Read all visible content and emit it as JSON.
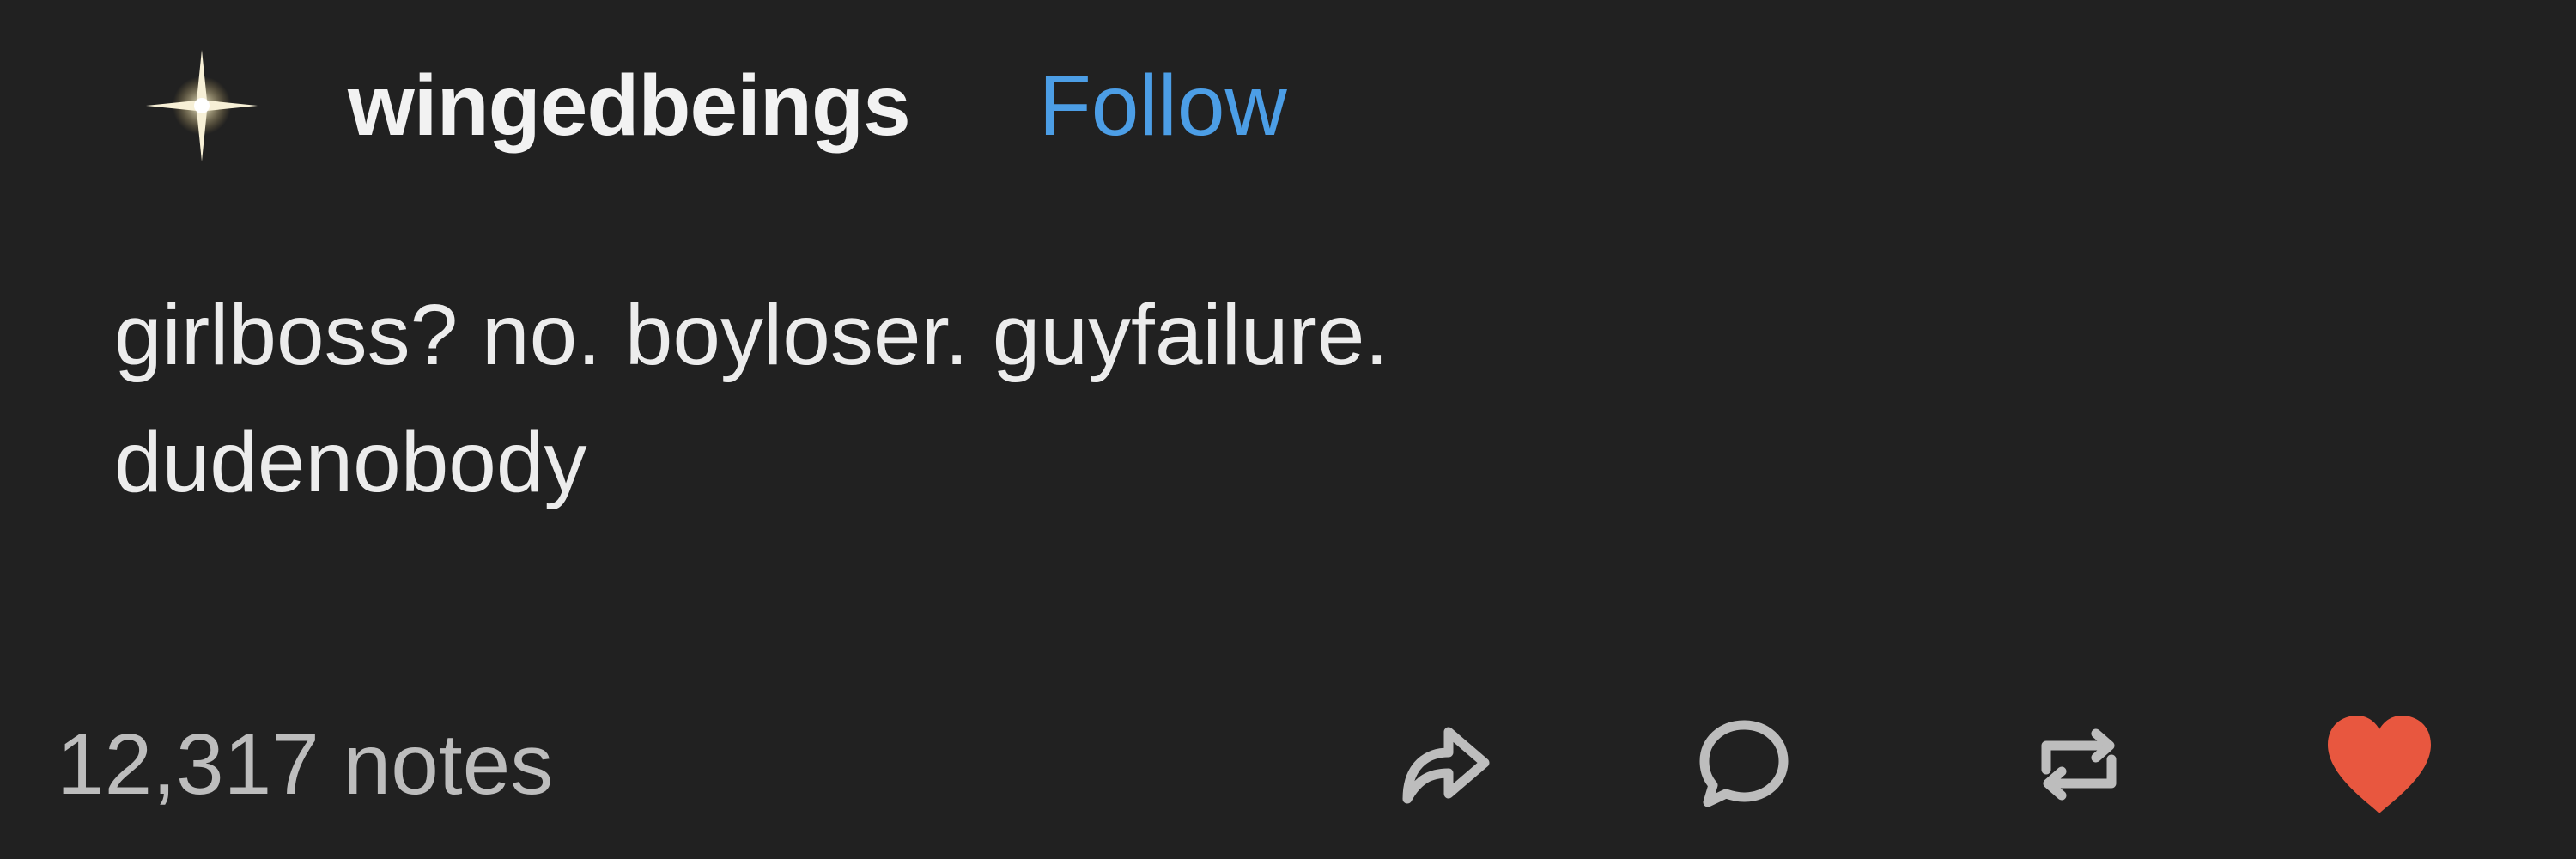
{
  "post": {
    "username": "wingedbeings",
    "follow_label": "Follow",
    "body_lines": [
      "girlboss? no. boyloser. guyfailure.",
      "dudenobody"
    ],
    "notes_label": "12,317 notes"
  },
  "icons": {
    "avatar": "sparkle-star-icon",
    "share": "share-arrow-icon",
    "reply": "speech-bubble-icon",
    "reblog": "reblog-loop-icon",
    "like": "heart-icon"
  },
  "colors": {
    "background": "#212121",
    "text": "#ececec",
    "follow_link": "#4c9ee6",
    "notes_text": "#bdbdbd",
    "icon_gray": "#bdbdbd",
    "like_red": "#e8573f"
  }
}
